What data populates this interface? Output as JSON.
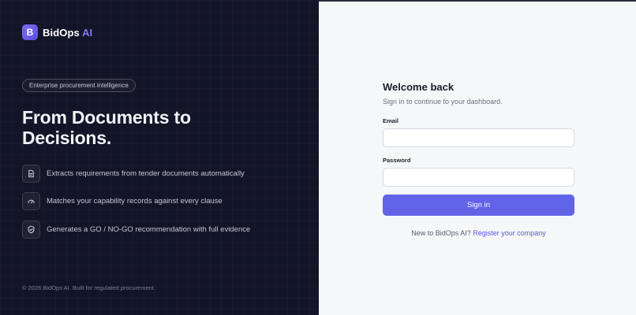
{
  "brand": {
    "name": "BidOps",
    "suffix": "AI"
  },
  "hero": {
    "pill": "Enterprise procurement intelligence",
    "headline_line1": "From Documents to",
    "headline_line2": "Decisions."
  },
  "features": [
    {
      "icon": "document-icon",
      "text": "Extracts requirements from tender documents automatically"
    },
    {
      "icon": "gauge-icon",
      "text": "Matches your capability records against every clause"
    },
    {
      "icon": "shield-check-icon",
      "text": "Generates a GO / NO-GO recommendation with full evidence"
    }
  ],
  "footer": "© 2026 BidOps AI. Built for regulated procurement.",
  "login": {
    "title": "Welcome back",
    "subtitle": "Sign in to continue to your dashboard.",
    "email_label": "Email",
    "email_value": "",
    "password_label": "Password",
    "password_value": "",
    "submit_label": "Sign in",
    "register_prompt": "New to BidOps AI?",
    "register_link": "Register your company"
  },
  "colors": {
    "accent": "#6264e8",
    "left_bg": "#121427",
    "right_bg": "#f6f7f9"
  }
}
